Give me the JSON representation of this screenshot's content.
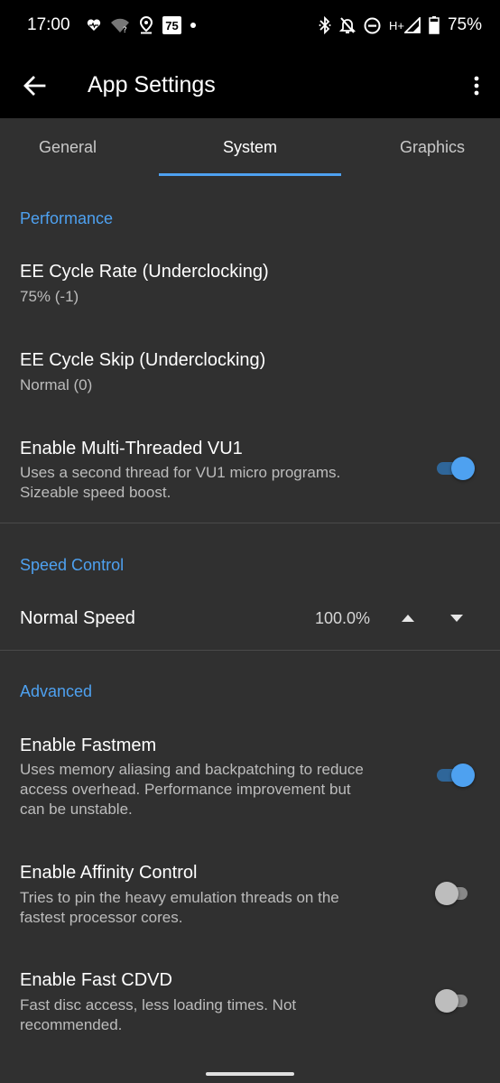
{
  "status_bar": {
    "time": "17:00",
    "left_icons": [
      "heart-monitor-icon",
      "wifi-question-icon",
      "location-pin-icon",
      "badge-75-icon",
      "notification-dot-icon"
    ],
    "badge_text": "75",
    "right_icons": [
      "bluetooth-icon",
      "bell-off-icon",
      "do-not-disturb-icon",
      "signal-icon",
      "battery-icon"
    ],
    "network": "H+",
    "battery": "75%"
  },
  "app_bar": {
    "title": "App Settings",
    "back_icon": "arrow-back-icon",
    "overflow_icon": "more-vert-icon"
  },
  "tabs": [
    {
      "label": "General",
      "active": false
    },
    {
      "label": "System",
      "active": true
    },
    {
      "label": "Graphics",
      "active": false
    }
  ],
  "accent_color": "#4ea1f0",
  "sections": {
    "performance": {
      "header": "Performance",
      "ee_cycle_rate": {
        "title": "EE Cycle Rate (Underclocking)",
        "value": "75% (-1)"
      },
      "ee_cycle_skip": {
        "title": "EE Cycle Skip (Underclocking)",
        "value": "Normal (0)"
      },
      "multi_threaded_vu1": {
        "title": "Enable Multi-Threaded VU1",
        "line1": "Uses a second thread for VU1 micro programs.",
        "line2": "Sizeable speed boost.",
        "enabled": true
      }
    },
    "speed_control": {
      "header": "Speed Control",
      "normal_speed": {
        "title": "Normal Speed",
        "value": "100.0%"
      }
    },
    "advanced": {
      "header": "Advanced",
      "fastmem": {
        "title": "Enable Fastmem",
        "line1": "Uses memory aliasing and backpatching to reduce",
        "line2": "access overhead. Performance improvement but",
        "line3": "can be unstable.",
        "enabled": true
      },
      "affinity": {
        "title": "Enable Affinity Control",
        "line1": "Tries to pin the heavy emulation threads on the",
        "line2": "fastest processor cores.",
        "enabled": false
      },
      "fast_cdvd": {
        "title": "Enable Fast CDVD",
        "line1": "Fast disc access, less loading times. Not",
        "line2": "recommended.",
        "enabled": false
      }
    }
  }
}
